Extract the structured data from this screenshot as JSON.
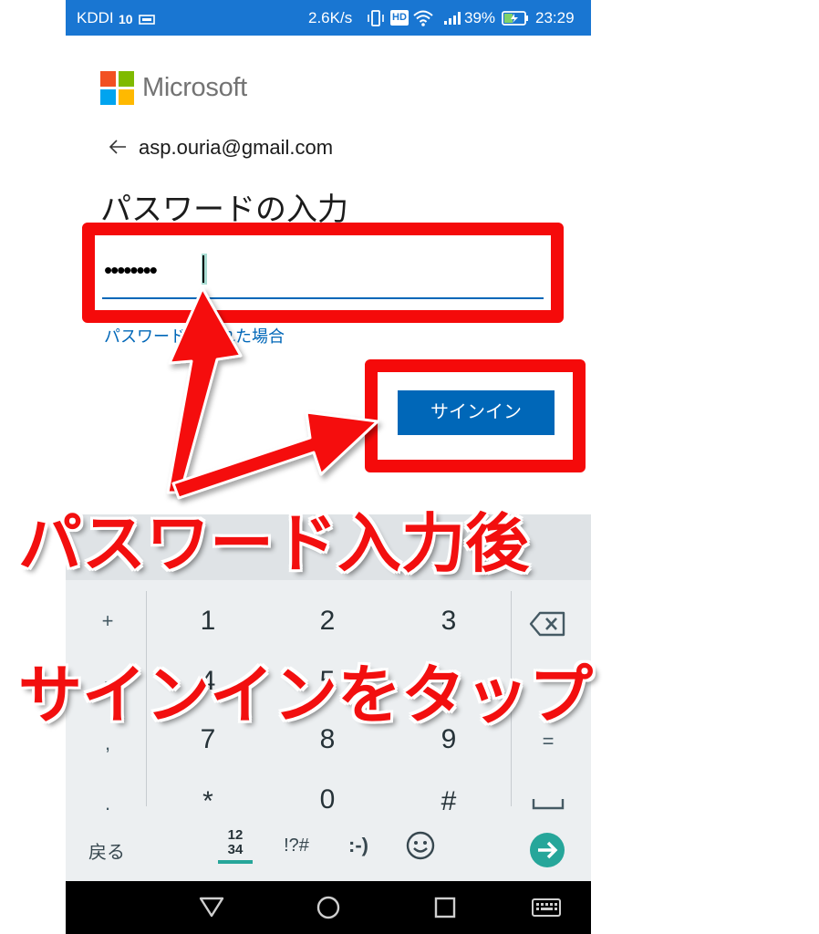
{
  "status_bar": {
    "carrier": "KDDI",
    "network": "10",
    "speed": "2.6K/s",
    "hd": "HD",
    "battery": "39%",
    "time": "23:29"
  },
  "brand": {
    "name": "Microsoft",
    "colors": {
      "red": "#f25022",
      "green": "#7fba00",
      "blue": "#00a4ef",
      "yellow": "#ffb900"
    }
  },
  "account": {
    "email": "asp.ouria@gmail.com"
  },
  "page": {
    "title": "パスワードの入力",
    "password_value": "••••••••",
    "forgot_link": "パスワードを忘れた場合",
    "signin_label": "サインイン"
  },
  "keyboard": {
    "rows": [
      {
        "left": "+",
        "keys": [
          "1",
          "2",
          "3"
        ],
        "right": "backspace-icon"
      },
      {
        "left": "-",
        "keys": [
          "4",
          "5",
          "6"
        ],
        "right": ""
      },
      {
        "left": ",",
        "keys": [
          "7",
          "8",
          "9"
        ],
        "right": "="
      },
      {
        "left": ".",
        "keys": [
          "*",
          "0",
          "#"
        ],
        "right": "space-icon"
      }
    ],
    "bottom": {
      "back": "戻る",
      "mode_top": "12",
      "mode_bottom": "34",
      "symbols": "!?#",
      "emoticon": ":-)"
    }
  },
  "annotation": {
    "line1": "パスワード入力後",
    "line2": "サインインをタップ",
    "color": "#f50a0a"
  }
}
